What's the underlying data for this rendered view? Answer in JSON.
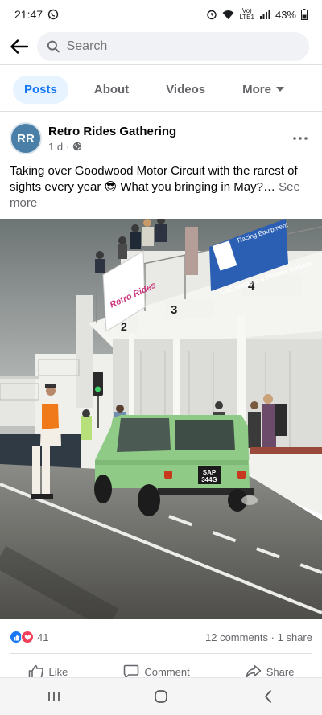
{
  "status": {
    "time": "21:47",
    "network_top": "Vo)",
    "network_bottom": "LTE1",
    "battery": "43%"
  },
  "search": {
    "placeholder": "Search"
  },
  "tabs": [
    {
      "label": "Posts"
    },
    {
      "label": "About"
    },
    {
      "label": "Videos"
    },
    {
      "label": "More"
    }
  ],
  "post": {
    "avatar_text": "RR",
    "page_name": "Retro Rides Gathering",
    "age": "1 d",
    "caption": "Taking over Goodwood Motor Circuit with the rarest of sights every year 😎 What you bringing in May?…",
    "see_more": "See more"
  },
  "photo": {
    "banner_left": "Retro Rides",
    "banner_right_top": "Racing Equipment",
    "banner_right_bottom": "CNC Welders & Plasma Cutters",
    "pit_numbers": [
      "2",
      "3",
      "4"
    ],
    "plate_top": "SAP",
    "plate_bottom": "344G"
  },
  "engagement": {
    "reaction_count": "41",
    "comments": "12 comments",
    "shares": "1 share"
  },
  "actions": {
    "like": "Like",
    "comment": "Comment",
    "share": "Share"
  },
  "colors": {
    "accent": "#1877f2",
    "love": "#f33e58",
    "car": "#8fcb87"
  }
}
